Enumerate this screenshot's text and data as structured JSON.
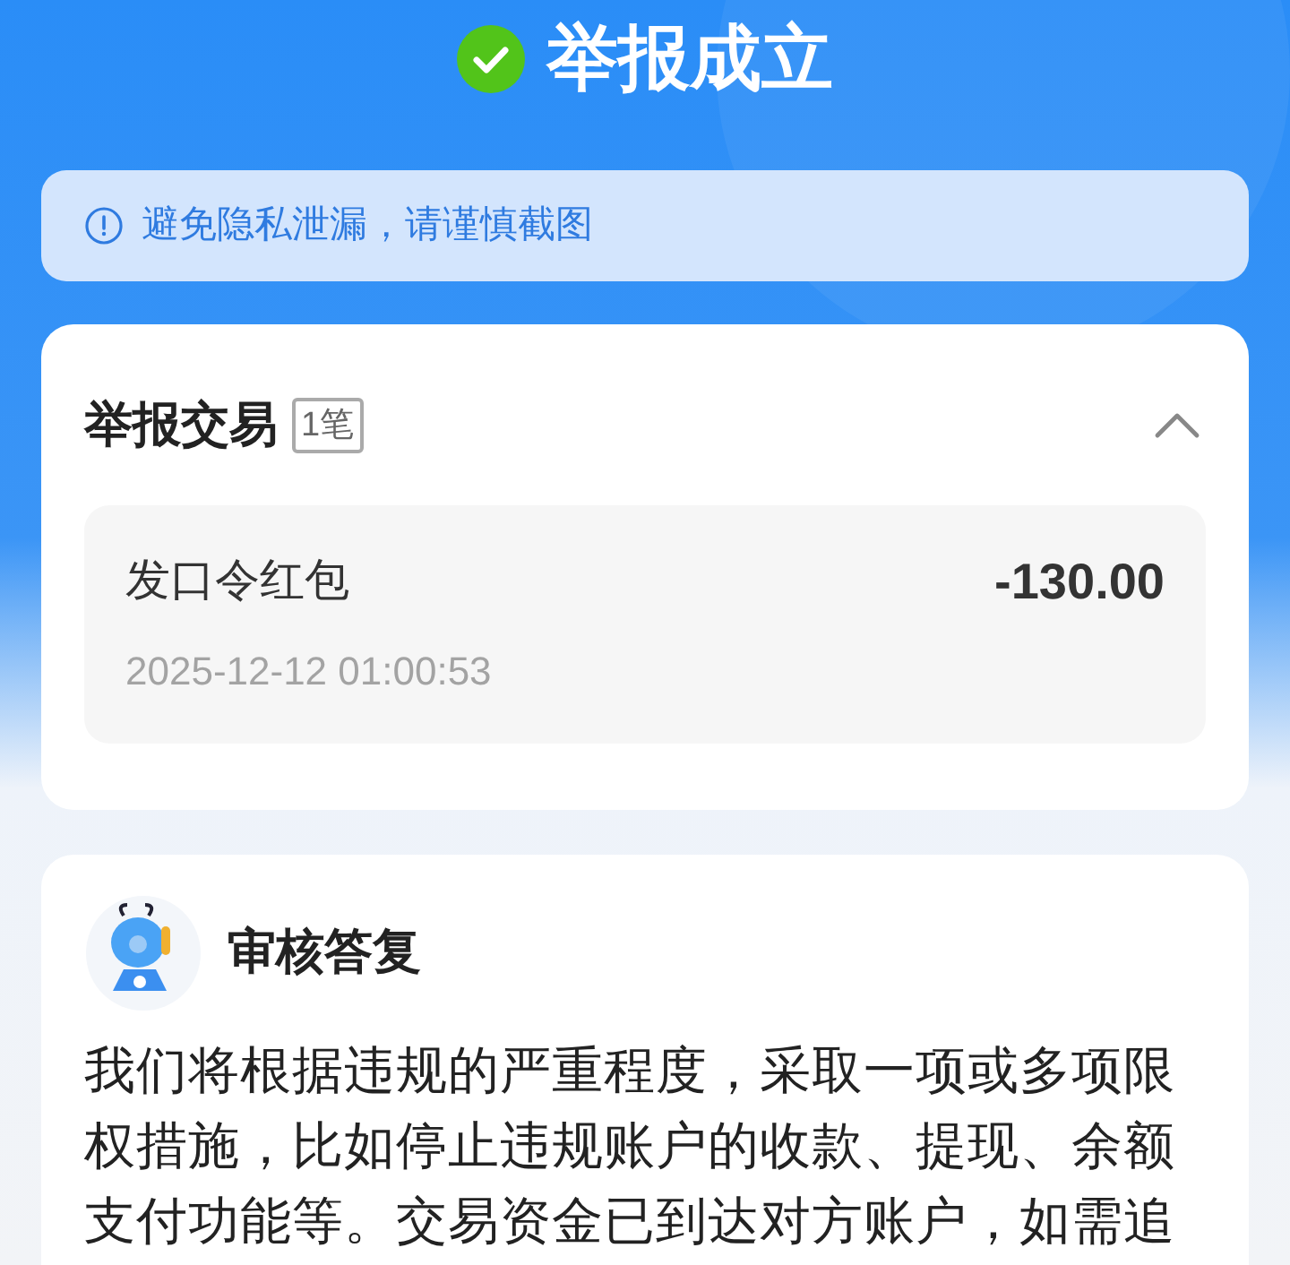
{
  "header": {
    "title": "举报成立"
  },
  "notice": {
    "text": "避免隐私泄漏，请谨慎截图"
  },
  "transactions": {
    "title": "举报交易",
    "count": "1笔",
    "expanded": true,
    "items": [
      {
        "name": "发口令红包",
        "amount": "-130.00",
        "time": "2025-12-12 01:00:53"
      }
    ]
  },
  "review": {
    "title": "审核答复",
    "text": "我们将根据违规的严重程度，采取一项或多项限权措施，比如停止违规账户的收款、提现、余额支付功能等。交易资金已到达对方账户，如需追"
  }
}
